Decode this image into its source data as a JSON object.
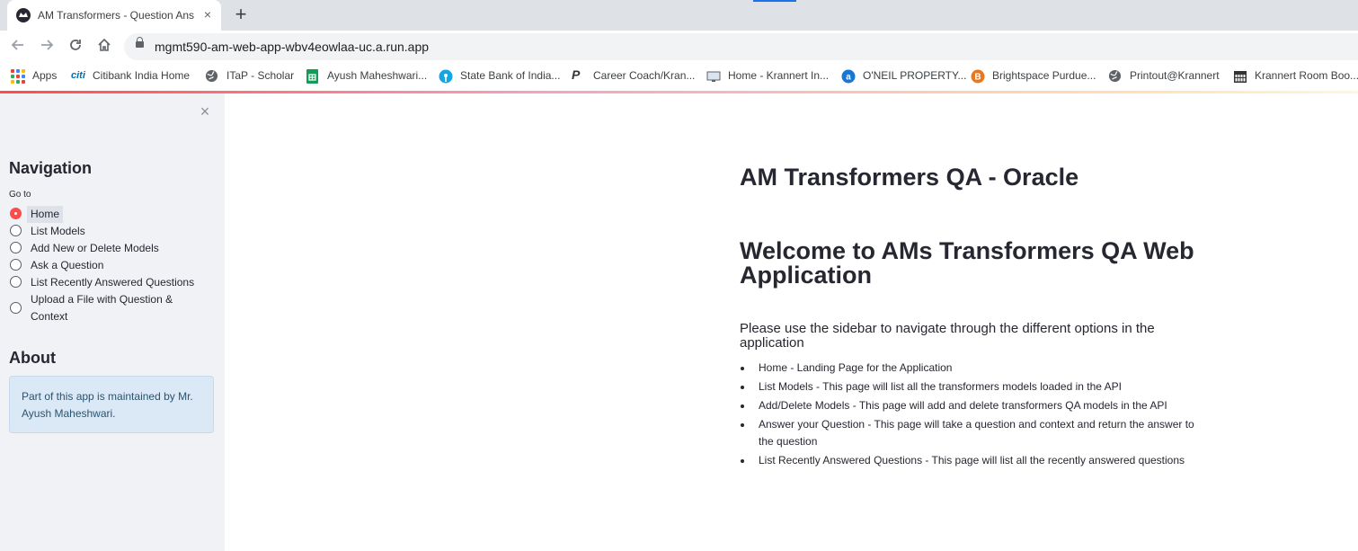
{
  "browser": {
    "tab_title": "AM Transformers - Question Ans",
    "tab_close": "×",
    "new_tab": "+",
    "url": "mgmt590-am-web-app-wbv4eowlaa-uc.a.run.app"
  },
  "bookmarks": [
    {
      "label": "Apps",
      "icon": "apps-grid-icon"
    },
    {
      "label": "Citibank India Home",
      "icon": "citi-icon"
    },
    {
      "label": "ITaP - Scholar",
      "icon": "globe-icon"
    },
    {
      "label": "Ayush Maheshwari...",
      "icon": "sheets-icon"
    },
    {
      "label": "State Bank of India...",
      "icon": "sbi-icon"
    },
    {
      "label": "Career Coach/Kran...",
      "icon": "purdue-p-icon"
    },
    {
      "label": "Home - Krannert In...",
      "icon": "monitor-icon"
    },
    {
      "label": "O'NEIL PROPERTY...",
      "icon": "a-circle-icon"
    },
    {
      "label": "Brightspace Purdue...",
      "icon": "brightspace-icon"
    },
    {
      "label": "Printout@Krannert",
      "icon": "globe-icon"
    },
    {
      "label": "Krannert Room Boo...",
      "icon": "calendar-icon"
    }
  ],
  "sidebar": {
    "close": "×",
    "navigation_title": "Navigation",
    "goto_label": "Go to",
    "options": [
      {
        "label": "Home",
        "selected": true
      },
      {
        "label": "List Models",
        "selected": false
      },
      {
        "label": "Add New or Delete Models",
        "selected": false
      },
      {
        "label": "Ask a Question",
        "selected": false
      },
      {
        "label": "List Recently Answered Questions",
        "selected": false
      },
      {
        "label": "Upload a File with Question & Context",
        "selected": false
      }
    ],
    "about_title": "About",
    "about_text": "Part of this app is maintained by Mr. Ayush Maheshwari."
  },
  "main": {
    "title": "AM Transformers QA - Oracle",
    "welcome": "Welcome to AMs Transformers QA Web Application",
    "intro": "Please use the sidebar to navigate through the different options in the application",
    "items": [
      "Home - Landing Page for the Application",
      "List Models - This page will list all the transformers models loaded in the API",
      "Add/Delete Models - This page will add and delete transformers QA models in the API",
      "Answer your Question - This page will take a question and context and return the answer to the question",
      "List Recently Answered Questions - This page will list all the recently answered questions"
    ]
  },
  "colors": {
    "accent": "#ff4b4b",
    "sidebar_bg": "#f0f2f6",
    "info_bg": "#dbe8f6",
    "text": "#262730"
  }
}
